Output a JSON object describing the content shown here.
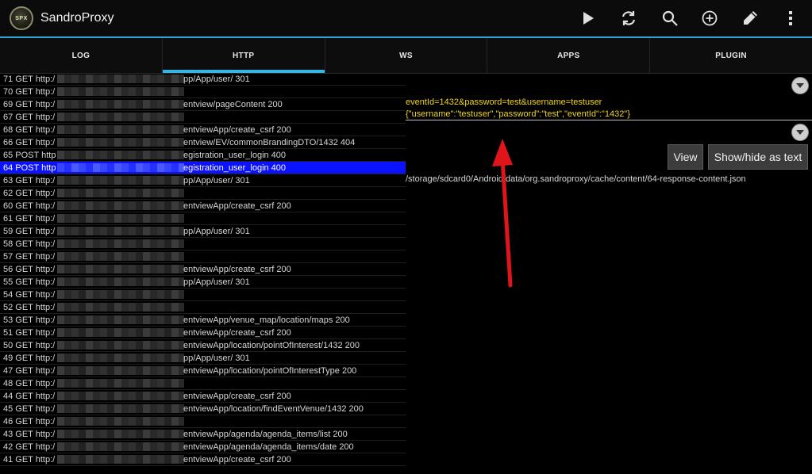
{
  "app": {
    "title": "SandroProxy",
    "icon_text": "SPX"
  },
  "actionbar": {
    "icons": [
      "play-icon",
      "refresh-icon",
      "search-icon",
      "add-circle-icon",
      "edit-icon",
      "overflow-menu-icon"
    ]
  },
  "tabs": [
    {
      "label": "LOG",
      "active": false
    },
    {
      "label": "HTTP",
      "active": true
    },
    {
      "label": "WS",
      "active": false
    },
    {
      "label": "APPS",
      "active": false
    },
    {
      "label": "PLUGIN",
      "active": false
    }
  ],
  "requests": [
    {
      "label": "71 GET http:/",
      "rest": "pp/App/user/ 301"
    },
    {
      "label": "70 GET http:/",
      "rest": ""
    },
    {
      "label": "69 GET http:/",
      "rest": "entview/pageContent 200"
    },
    {
      "label": "67 GET http:/",
      "rest": ""
    },
    {
      "label": "68 GET http:/",
      "rest": "entviewApp/create_csrf 200"
    },
    {
      "label": "66 GET http:/",
      "rest": "entview/EV/commonBrandingDTO/1432 404"
    },
    {
      "label": "65 POST http",
      "rest": "egistration_user_login 400"
    },
    {
      "label": "64 POST http",
      "rest": "egistration_user_login 400",
      "selected": true
    },
    {
      "label": "63 GET http:/",
      "rest": "pp/App/user/ 301"
    },
    {
      "label": "62 GET http:/",
      "rest": ""
    },
    {
      "label": "60 GET http:/",
      "rest": "entviewApp/create_csrf 200"
    },
    {
      "label": "61 GET http:/",
      "rest": ""
    },
    {
      "label": "59 GET http:/",
      "rest": "pp/App/user/ 301"
    },
    {
      "label": "58 GET http:/",
      "rest": ""
    },
    {
      "label": "57 GET http:/",
      "rest": ""
    },
    {
      "label": "56 GET http:/",
      "rest": "entviewApp/create_csrf 200"
    },
    {
      "label": "55 GET http:/",
      "rest": "pp/App/user/ 301"
    },
    {
      "label": "54 GET http:/",
      "rest": ""
    },
    {
      "label": "52 GET http:/",
      "rest": ""
    },
    {
      "label": "53 GET http:/",
      "rest": "entviewApp/venue_map/location/maps 200"
    },
    {
      "label": "51 GET http:/",
      "rest": "entviewApp/create_csrf 200"
    },
    {
      "label": "50 GET http:/",
      "rest": "entviewApp/location/pointOfInterest/1432 200"
    },
    {
      "label": "49 GET http:/",
      "rest": "pp/App/user/ 301"
    },
    {
      "label": "47 GET http:/",
      "rest": "entviewApp/location/pointOfInterestType 200"
    },
    {
      "label": "48 GET http:/",
      "rest": ""
    },
    {
      "label": "44 GET http:/",
      "rest": "entviewApp/create_csrf 200"
    },
    {
      "label": "45 GET http:/",
      "rest": "entviewApp/location/findEventVenue/1432 200"
    },
    {
      "label": "46 GET http:/",
      "rest": ""
    },
    {
      "label": "43 GET http:/",
      "rest": "entviewApp/agenda/agenda_items/list 200"
    },
    {
      "label": "42 GET http:/",
      "rest": "entviewApp/agenda/agenda_items/date 200"
    },
    {
      "label": "41 GET http:/",
      "rest": "entviewApp/create_csrf 200"
    }
  ],
  "detail": {
    "request_body_line1": "eventId=1432&password=test&username=testuser",
    "request_body_line2": "{\"username\":\"testuser\",\"password\":\"test\",\"eventId\":\"1432\"}",
    "view_button": "View",
    "toggle_button": "Show/hide as text",
    "response_path": "/storage/sdcard0/Android/data/org.sandroproxy/cache/content/64-response-content.json"
  },
  "colors": {
    "accent": "#33b5e5",
    "selected_row": "#0b12ff",
    "request_text": "#f1d51b",
    "annotation_arrow": "#e0141b"
  }
}
